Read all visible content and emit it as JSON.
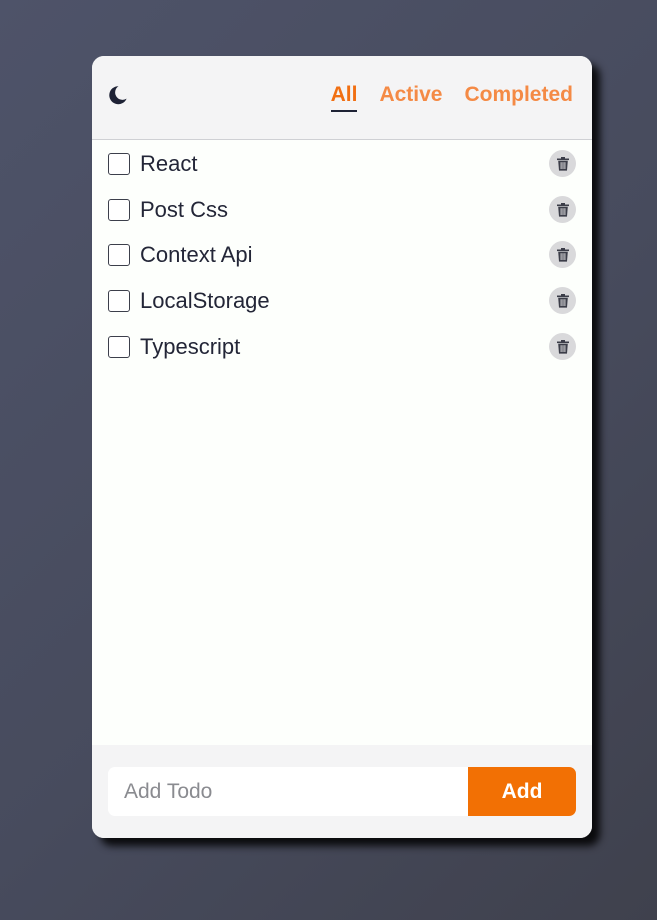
{
  "header": {
    "theme_toggle_icon": "moon-icon",
    "tabs": [
      {
        "label": "All",
        "active": true
      },
      {
        "label": "Active",
        "active": false
      },
      {
        "label": "Completed",
        "active": false
      }
    ]
  },
  "todos": [
    {
      "label": "React",
      "checked": false
    },
    {
      "label": "Post Css",
      "checked": false
    },
    {
      "label": "Context Api",
      "checked": false
    },
    {
      "label": "LocalStorage",
      "checked": false
    },
    {
      "label": "Typescript",
      "checked": false
    }
  ],
  "footer": {
    "input_value": "",
    "input_placeholder": "Add Todo",
    "add_label": "Add"
  },
  "colors": {
    "accent": "#f27004",
    "tab_inactive": "#f48a45",
    "text": "#232637",
    "trash_bg": "#d9d9db"
  }
}
